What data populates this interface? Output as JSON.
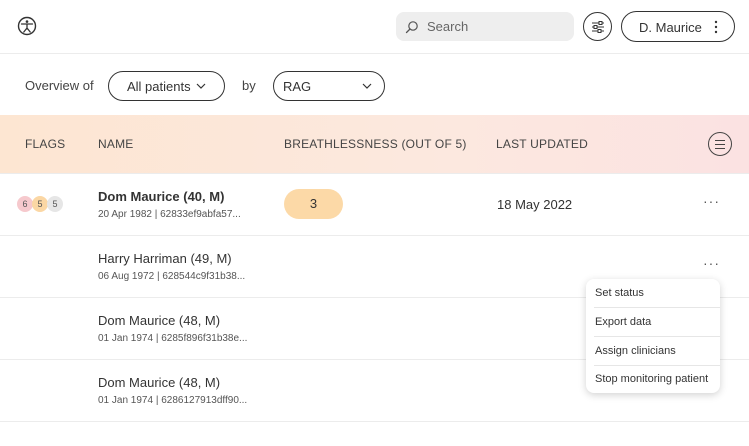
{
  "header": {
    "logo_icon": "accessibility-person-icon",
    "search_placeholder": "Search",
    "user_name": "D. Maurice"
  },
  "controls": {
    "overview_label": "Overview of",
    "patients_value": "All patients",
    "by_label": "by",
    "grouping_value": "RAG"
  },
  "table": {
    "columns": [
      "FLAGS",
      "NAME",
      "BREATHLESSNESS (OUT OF 5)",
      "LAST UPDATED"
    ],
    "rows": [
      {
        "flags": [
          {
            "value": "6",
            "color": "#f6c9cd"
          },
          {
            "value": "5",
            "color": "#fbd7a4"
          },
          {
            "value": "5",
            "color": "#e6e6e6"
          }
        ],
        "name": "Dom Maurice (40, M)",
        "sub": "20 Apr 1982 | 62833ef9abfa57...",
        "score": "3",
        "score_color": "#fcd9a7",
        "updated": "18 May 2022",
        "menu": "···"
      },
      {
        "name": "Harry Harriman (49, M)",
        "sub": "06 Aug 1972 | 628544c9f31b38...",
        "menu": "···"
      },
      {
        "name": "Dom Maurice (48, M)",
        "sub": "01 Jan 1974 | 6285f896f31b38e..."
      },
      {
        "name": "Dom Maurice (48, M)",
        "sub": "01 Jan 1974 | 6286127913dff90..."
      }
    ]
  },
  "row_menu": {
    "items": [
      "Set status",
      "Export data",
      "Assign clinicians",
      "Stop monitoring patient"
    ]
  },
  "colors": {
    "header_gradient_start": "#fde6d2",
    "header_gradient_end": "#fbe2e2"
  }
}
